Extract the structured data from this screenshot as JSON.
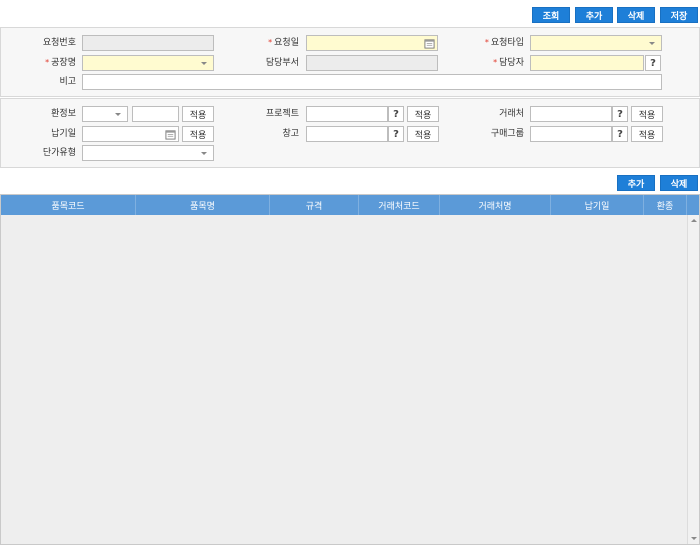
{
  "toolbar": {
    "search": "조회",
    "add": "추가",
    "delete": "삭제",
    "save": "저장"
  },
  "header_form": {
    "request_no": {
      "label": "요청번호",
      "value": ""
    },
    "request_date": {
      "label": "요청일",
      "value": ""
    },
    "request_type": {
      "label": "요청타입",
      "value": ""
    },
    "plant": {
      "label": "공장명",
      "value": ""
    },
    "dept": {
      "label": "담당부서",
      "value": ""
    },
    "manager": {
      "label": "담당자",
      "value": ""
    },
    "remark": {
      "label": "비고",
      "value": ""
    }
  },
  "filter_form": {
    "currency": {
      "label": "환정보",
      "value": ""
    },
    "project": {
      "label": "프로젝트"
    },
    "vendor": {
      "label": "거래처"
    },
    "delivery_date": {
      "label": "납기일"
    },
    "warehouse": {
      "label": "창고"
    },
    "purchase_group": {
      "label": "구매그룹"
    },
    "price_type": {
      "label": "단가유형",
      "value": ""
    },
    "apply_label": "적용",
    "question": "?"
  },
  "grid_toolbar": {
    "add": "추가",
    "delete": "삭제"
  },
  "grid": {
    "columns": [
      "품목코드",
      "품목명",
      "규격",
      "거래처코드",
      "거래처명",
      "납기일",
      "환종"
    ],
    "rows": []
  }
}
